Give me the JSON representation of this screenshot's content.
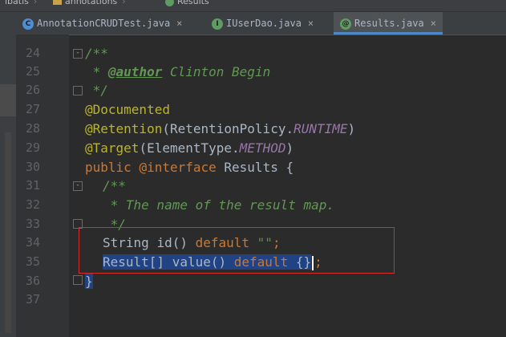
{
  "breadcrumbs": [
    "ibatis",
    "annotations",
    "Results"
  ],
  "tabs": [
    {
      "icon_letter": "C",
      "icon_color": "#4f8fd1",
      "label": "AnnotationCRUDTest.java",
      "close": "×",
      "active": false
    },
    {
      "icon_letter": "I",
      "icon_color": "#5e9c63",
      "label": "IUserDao.java",
      "close": "×",
      "active": false
    },
    {
      "icon_letter": "@",
      "icon_color": "#5e9c63",
      "label": "Results.java",
      "close": "×",
      "active": true
    }
  ],
  "editor": {
    "line_numbers": [
      "24",
      "25",
      "26",
      "27",
      "28",
      "29",
      "30",
      "31",
      "32",
      "33",
      "34",
      "35",
      "36",
      "37"
    ],
    "lines": {
      "l24": "/**",
      "l25_star": " * ",
      "l25_tag": "@author",
      "l25_rest": " Clinton Begin",
      "l26": " */",
      "l27": "@Documented",
      "l28_ann": "@Retention",
      "l28_a": "(RetentionPolicy.",
      "l28_it": "RUNTIME",
      "l28_b": ")",
      "l29_ann": "@Target",
      "l29_a": "(ElementType.",
      "l29_it": "METHOD",
      "l29_b": ")",
      "l30_kw": "public ",
      "l30_ann": "@interface",
      "l30_rest": " Results {",
      "l31": "/**",
      "l32": " * The name of the result map.",
      "l33": " */",
      "l34_a": "String ",
      "l34_b": "id() ",
      "l34_kw": "default ",
      "l34_str": "\"\"",
      "l34_end": ";",
      "l35_a": "Result[] value() ",
      "l35_kw": "default",
      "l35_b": " {}",
      "l35_end": ";",
      "l36": "}"
    }
  },
  "colors": {
    "comment": "#629755",
    "annotation": "#bbb529",
    "keyword": "#cc7832",
    "constant": "#9876aa",
    "selection": "#214283",
    "highlight_box": "#d92c2c"
  }
}
